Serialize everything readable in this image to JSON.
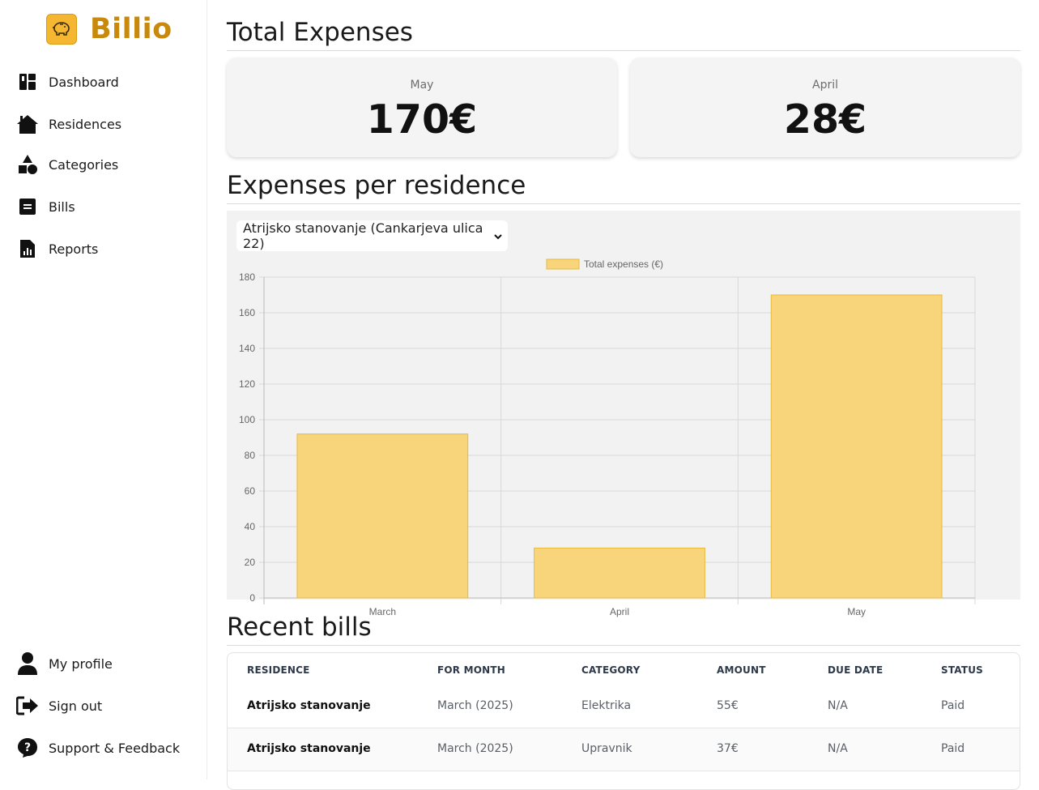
{
  "brand": {
    "name": "Billio",
    "logo_icon": "piggy-bank-icon",
    "accent": "#c98a0c"
  },
  "sidebar": {
    "items": [
      {
        "label": "Dashboard",
        "icon": "dashboard-icon"
      },
      {
        "label": "Residences",
        "icon": "house-icon"
      },
      {
        "label": "Categories",
        "icon": "shapes-icon"
      },
      {
        "label": "Bills",
        "icon": "bill-icon"
      },
      {
        "label": "Reports",
        "icon": "report-icon"
      }
    ],
    "bottom_items": [
      {
        "label": "My profile",
        "icon": "user-icon"
      },
      {
        "label": "Sign out",
        "icon": "sign-out-icon"
      },
      {
        "label": "Support & Feedback",
        "icon": "help-icon"
      }
    ]
  },
  "total_expenses": {
    "title": "Total Expenses",
    "cards": [
      {
        "month": "May",
        "value": "170€"
      },
      {
        "month": "April",
        "value": "28€"
      }
    ]
  },
  "per_residence": {
    "title": "Expenses per residence",
    "selected_residence": "Atrijsko stanovanje (Cankarjeva ulica 22)"
  },
  "chart_data": {
    "type": "bar",
    "categories": [
      "March",
      "April",
      "May"
    ],
    "series": [
      {
        "name": "Total expenses (€)",
        "values": [
          92,
          28,
          170
        ],
        "color": "#f8d57a",
        "border": "#e9b93e"
      }
    ],
    "yticks": [
      "0",
      "20",
      "40",
      "60",
      "80",
      "100",
      "120",
      "140",
      "160",
      "180"
    ],
    "ylim": [
      0,
      180
    ],
    "legend": "top-center",
    "grid": true
  },
  "recent_bills": {
    "title": "Recent bills",
    "columns": [
      "RESIDENCE",
      "FOR MONTH",
      "CATEGORY",
      "AMOUNT",
      "DUE DATE",
      "STATUS"
    ],
    "rows": [
      [
        "Atrijsko stanovanje",
        "March (2025)",
        "Elektrika",
        "55€",
        "N/A",
        "Paid"
      ],
      [
        "Atrijsko stanovanje",
        "March (2025)",
        "Upravnik",
        "37€",
        "N/A",
        "Paid"
      ]
    ]
  }
}
